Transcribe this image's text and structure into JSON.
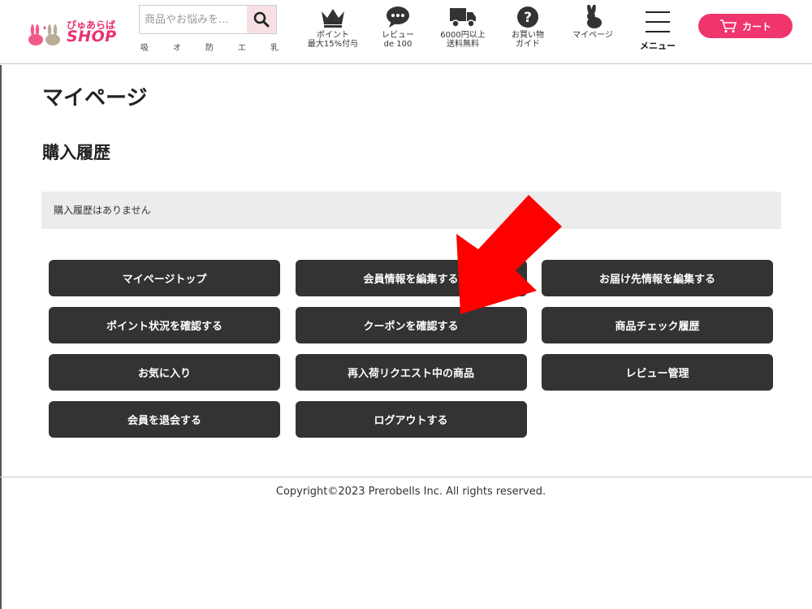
{
  "header": {
    "logo": {
      "top": "ぴゅあらば",
      "bottom": "SHOP"
    },
    "search": {
      "placeholder": "商品やお悩みを…"
    },
    "keywords": [
      "吸",
      "オ",
      "防",
      "エ",
      "乳"
    ],
    "nav": [
      {
        "label": "ポイント\n最大15%付与",
        "icon": "crown-icon"
      },
      {
        "label": "レビュー\nde 100",
        "icon": "speech-bubble-icon"
      },
      {
        "label": "6000円以上\n送料無料",
        "icon": "truck-icon"
      },
      {
        "label": "お買い物\nガイド",
        "icon": "question-icon"
      },
      {
        "label": "マイページ",
        "icon": "rabbit-icon"
      }
    ],
    "menu_label": "メニュー",
    "cart_label": "カート"
  },
  "main": {
    "page_title": "マイページ",
    "section_title": "購入履歴",
    "notice": "購入履歴はありません",
    "buttons": [
      "マイページトップ",
      "会員情報を編集する",
      "お届け先情報を編集する",
      "ポイント状況を確認する",
      "クーポンを確認する",
      "商品チェック履歴",
      "お気に入り",
      "再入荷リクエスト中の商品",
      "レビュー管理",
      "会員を退会する",
      "ログアウトする"
    ]
  },
  "footer": {
    "copyright": "Copyright©2023 Prerobells Inc. All rights reserved."
  },
  "colors": {
    "brand_pink": "#f0346c",
    "button_dark": "#333333",
    "annotation_arrow": "#ff0000"
  }
}
